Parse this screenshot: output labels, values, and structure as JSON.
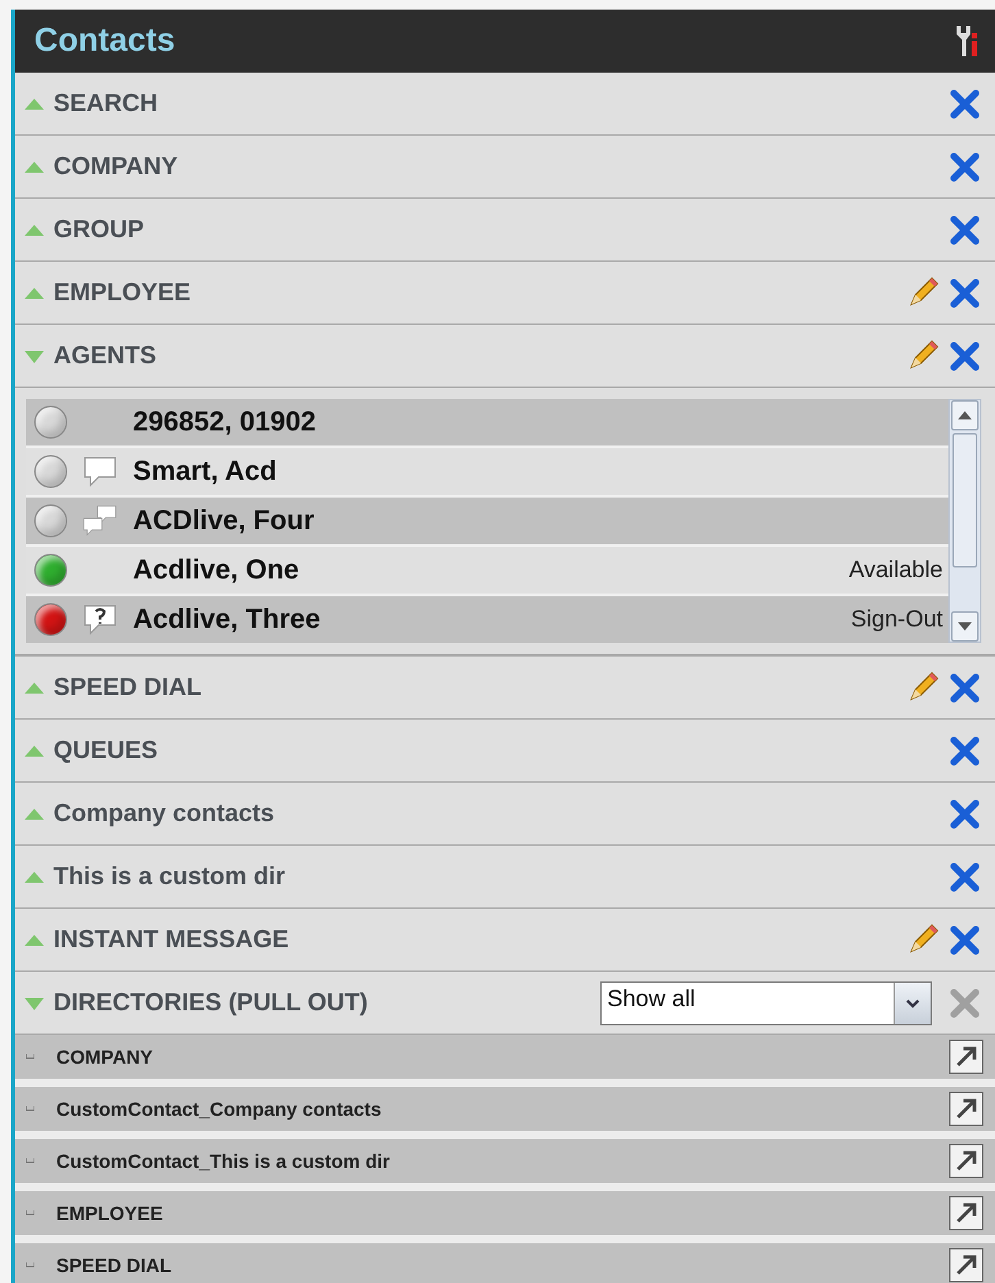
{
  "panel": {
    "title": "Contacts"
  },
  "sections": [
    {
      "kind": "plain",
      "title": "SEARCH",
      "expanded": false,
      "editable": false,
      "close_disabled": false
    },
    {
      "kind": "plain",
      "title": "COMPANY",
      "expanded": false,
      "editable": false,
      "close_disabled": false
    },
    {
      "kind": "plain",
      "title": "GROUP",
      "expanded": false,
      "editable": false,
      "close_disabled": false
    },
    {
      "kind": "plain",
      "title": "EMPLOYEE",
      "expanded": false,
      "editable": true,
      "close_disabled": false
    },
    {
      "kind": "agents",
      "title": "AGENTS",
      "expanded": true,
      "editable": true,
      "close_disabled": false,
      "agents": [
        {
          "name": "296852, 01902",
          "color": "#d8d8d8",
          "kind": "plain"
        },
        {
          "name": "Smart, Acd",
          "color": "#d8d8d8",
          "kind": "chat"
        },
        {
          "name": "ACDlive, Four",
          "color": "#d8d8d8",
          "kind": "multichat"
        },
        {
          "name": "Acdlive, One",
          "color": "#2fae2f",
          "kind": "plain",
          "status": "Available"
        },
        {
          "name": "Acdlive, Three",
          "color": "#d21414",
          "kind": "unknown",
          "status": "Sign-Out"
        }
      ]
    },
    {
      "kind": "plain",
      "title": "SPEED DIAL",
      "expanded": false,
      "editable": true,
      "close_disabled": false
    },
    {
      "kind": "plain",
      "title": "QUEUES",
      "expanded": false,
      "editable": false,
      "close_disabled": false
    },
    {
      "kind": "plain",
      "title": "Company contacts",
      "expanded": false,
      "editable": false,
      "close_disabled": false
    },
    {
      "kind": "plain",
      "title": "This is a custom dir",
      "expanded": false,
      "editable": false,
      "close_disabled": false
    },
    {
      "kind": "plain",
      "title": "INSTANT MESSAGE",
      "expanded": false,
      "editable": true,
      "close_disabled": false
    },
    {
      "kind": "directories",
      "title": "DIRECTORIES (PULL OUT)",
      "expanded": true,
      "editable": false,
      "close_disabled": true,
      "filter": "Show all",
      "directories": [
        {
          "name": "COMPANY"
        },
        {
          "name": "CustomContact_Company contacts"
        },
        {
          "name": "CustomContact_This is a custom dir"
        },
        {
          "name": "EMPLOYEE"
        },
        {
          "name": "SPEED DIAL"
        }
      ]
    }
  ]
}
